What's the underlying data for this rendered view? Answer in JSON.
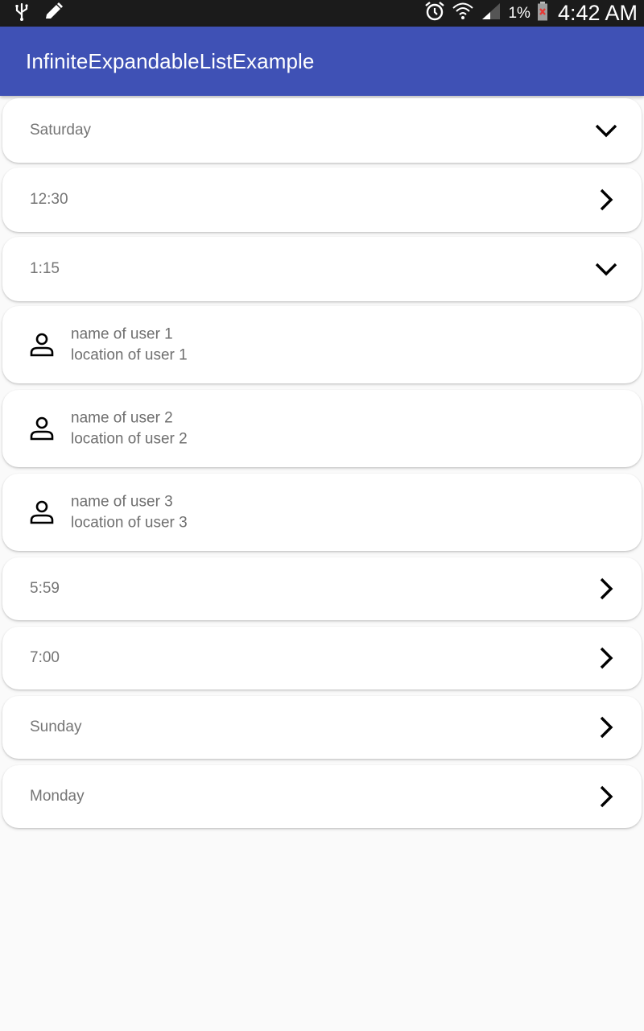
{
  "status_bar": {
    "battery_percent": "1%",
    "time": "4:42 AM",
    "icons": [
      "usb-icon",
      "pencil-icon",
      "alarm-icon",
      "wifi-icon",
      "signal-icon",
      "battery-icon"
    ]
  },
  "app_bar": {
    "title": "InfiniteExpandableListExample",
    "color": "#3f51b5"
  },
  "list": {
    "groups": [
      {
        "label": "Saturday",
        "state": "expanded"
      },
      {
        "label": "12:30",
        "state": "collapsed"
      },
      {
        "label": "1:15",
        "state": "expanded"
      },
      {
        "label": "5:59",
        "state": "collapsed"
      },
      {
        "label": "7:00",
        "state": "collapsed"
      },
      {
        "label": "Sunday",
        "state": "collapsed"
      },
      {
        "label": "Monday",
        "state": "collapsed"
      }
    ],
    "users": [
      {
        "name": "name of user 1",
        "location": "location of user 1"
      },
      {
        "name": "name of user 2",
        "location": "location of user 2"
      },
      {
        "name": "name of user 3",
        "location": "location of user 3"
      }
    ]
  }
}
